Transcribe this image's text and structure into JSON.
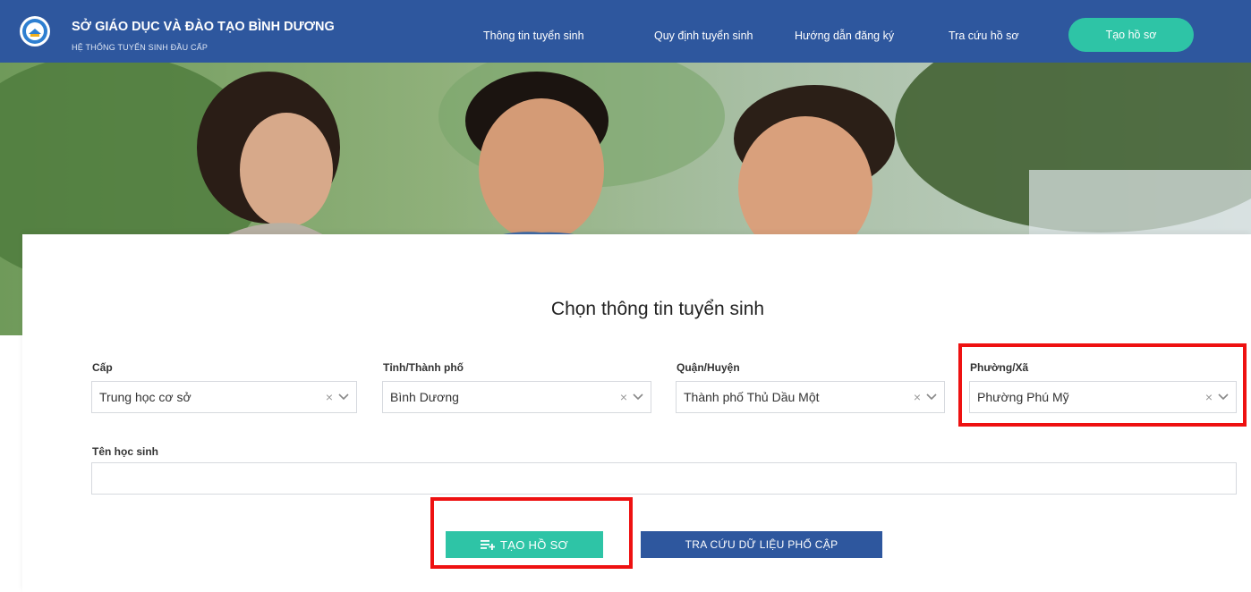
{
  "header": {
    "title": "SỞ GIÁO DỤC VÀ ĐÀO TẠO BÌNH DƯƠNG",
    "subtitle": "HỆ THỐNG TUYỂN SINH ĐẦU CẤP",
    "nav": [
      {
        "label": "Thông tin tuyển sinh"
      },
      {
        "label": "Quy định tuyển sinh"
      },
      {
        "label": "Hướng dẫn đăng ký"
      },
      {
        "label": "Tra cứu hồ sơ"
      }
    ],
    "cta_label": "Tạo hồ sơ"
  },
  "form": {
    "title": "Chọn thông tin tuyển sinh",
    "fields": [
      {
        "label": "Cấp",
        "value": "Trung học cơ sở"
      },
      {
        "label": "Tỉnh/Thành phố",
        "value": "Bình Dương"
      },
      {
        "label": "Quận/Huyện",
        "value": "Thành phố Thủ Dầu Một"
      },
      {
        "label": "Phường/Xã",
        "value": "Phường Phú Mỹ"
      }
    ],
    "student_name_label": "Tên học sinh",
    "student_name_value": "",
    "clear_symbol": "×",
    "create_button_label": "TẠO HỒ SƠ",
    "lookup_button_label": "TRA CỨU DỮ LIỆU PHỔ CẬP"
  },
  "colors": {
    "header_bg": "#2e579e",
    "accent_green": "#2ec4a6",
    "highlight_red": "#ee1111"
  }
}
